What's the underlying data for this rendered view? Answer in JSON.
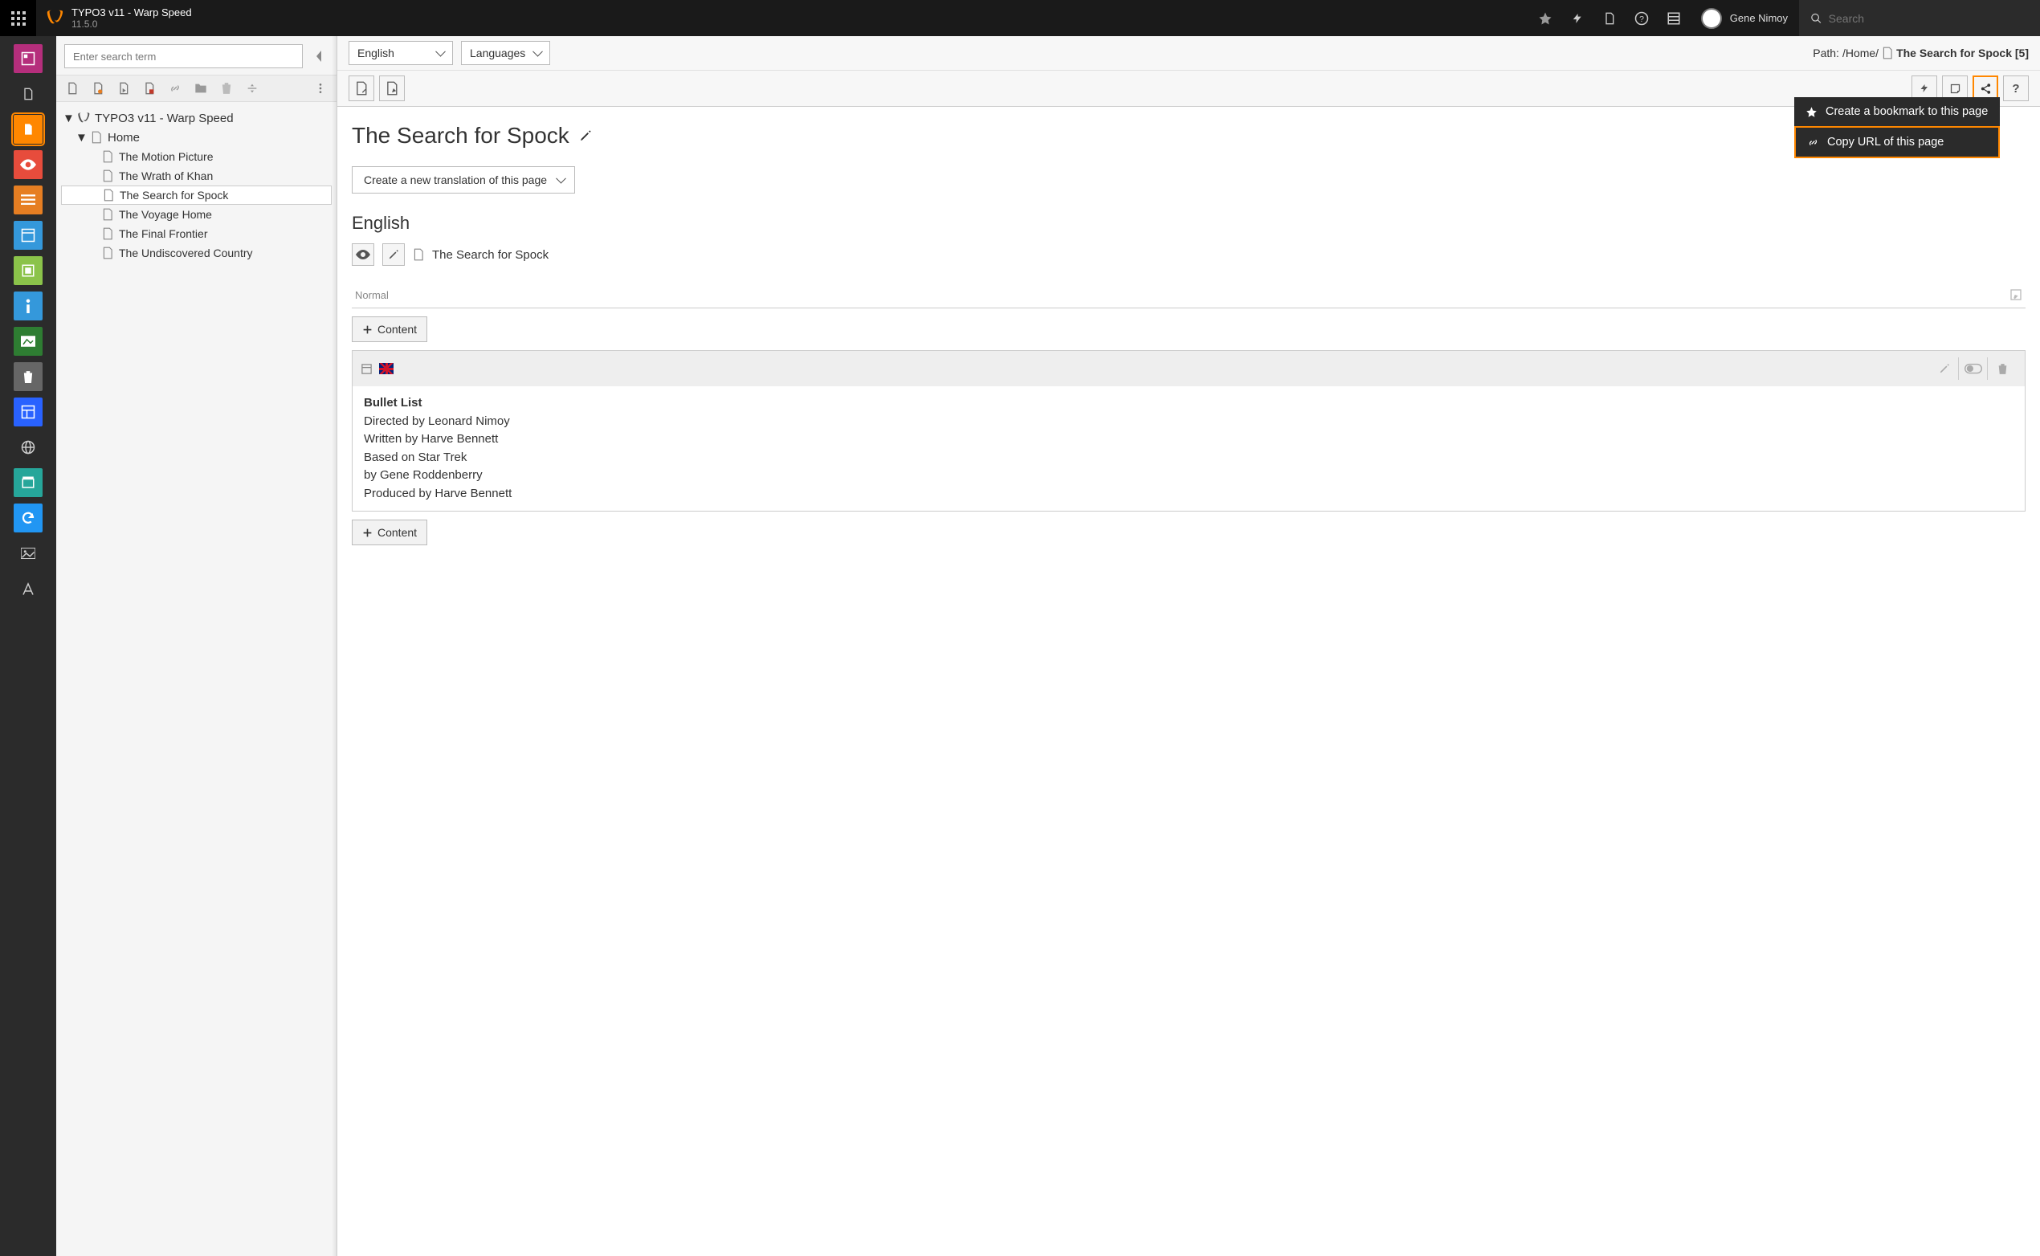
{
  "topbar": {
    "title": "TYPO3 v11 - Warp Speed",
    "version": "11.5.0",
    "user": "Gene Nimoy",
    "search_placeholder": "Search"
  },
  "tree": {
    "search_placeholder": "Enter search term",
    "root": "TYPO3 v11 - Warp Speed",
    "home": "Home",
    "pages": [
      "The Motion Picture",
      "The Wrath of Khan",
      "The Search for Spock",
      "The Voyage Home",
      "The Final Frontier",
      "The Undiscovered Country"
    ],
    "selected_index": 2
  },
  "docheader": {
    "lang_select": "English",
    "view_select": "Languages",
    "path_label": "Path: ",
    "path_segments": "/Home/",
    "path_current": "The Search for Spock [5]"
  },
  "share_menu": {
    "bookmark": "Create a bookmark to this page",
    "copy_url": "Copy URL of this page"
  },
  "page": {
    "title": "The Search for Spock",
    "translate_btn": "Create a new translation of this page",
    "lang_heading": "English",
    "record_title": "The Search for Spock",
    "column_label": "Normal",
    "content_btn": "Content",
    "element": {
      "title": "Bullet List",
      "lines": [
        "Directed by Leonard Nimoy",
        "Written by Harve Bennett",
        "Based on Star Trek",
        "by Gene Roddenberry",
        "Produced by Harve Bennett"
      ]
    }
  },
  "colors": {
    "accent": "#ff8700"
  }
}
